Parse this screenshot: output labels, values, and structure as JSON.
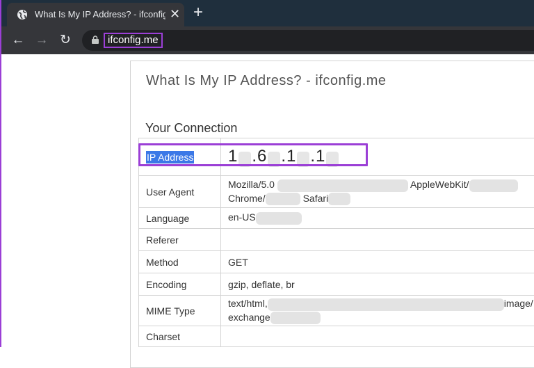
{
  "browser": {
    "tab_title": "What Is My IP Address? - ifconfig.me",
    "url": "ifconfig.me"
  },
  "page": {
    "title": "What Is My IP Address? - ifconfig.me",
    "section": "Your Connection",
    "rows": [
      {
        "label": "IP Address",
        "value": [
          "1",
          ".6",
          ".1",
          ".1"
        ]
      },
      {
        "label": "User Agent",
        "value_line1_a": "Mozilla/5.0",
        "value_line1_b": "AppleWebKit/",
        "value_line2_a": "Chrome/",
        "value_line2_b": "Safari"
      },
      {
        "label": "Language",
        "value": "en-US"
      },
      {
        "label": "Referer",
        "value": ""
      },
      {
        "label": "Method",
        "value": "GET"
      },
      {
        "label": "Encoding",
        "value": "gzip, deflate, br"
      },
      {
        "label": "MIME Type",
        "value_line1_a": "text/html,",
        "value_line1_b": "image/",
        "value_line2_a": "exchange"
      },
      {
        "label": "Charset",
        "value": ""
      }
    ]
  },
  "colors": {
    "highlight": "#9b3fd6",
    "selection": "#3b78e7",
    "tabstrip": "#1f2f3d"
  }
}
